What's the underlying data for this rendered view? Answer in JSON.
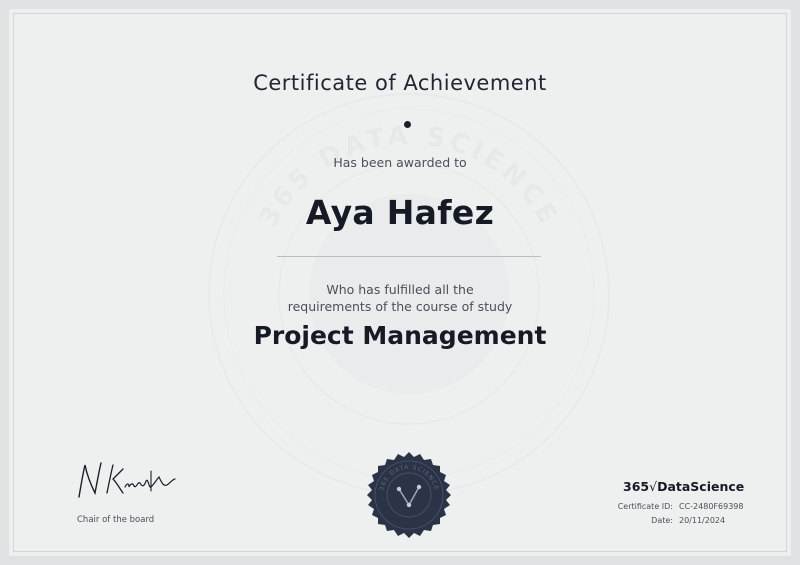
{
  "certificate": {
    "title": "Certificate of Achievement",
    "awarded_text": "Has been awarded to",
    "recipient_name": "Aya Hafez",
    "fulfilled_line1": "Who has fulfilled all the",
    "fulfilled_line2": "requirements of the course of study",
    "course_name": "Project Management"
  },
  "watermark": {
    "text": "365 DATA SCIENCE"
  },
  "signature": {
    "text": "N Krastev",
    "label": "Chair of the board"
  },
  "brand": {
    "number": "365",
    "check": "√",
    "name": "DataScience"
  },
  "meta": {
    "certificate_id_label": "Certificate ID:",
    "certificate_id_value": "CC-2480F69398",
    "date_label": "Date:",
    "date_value": "20/11/2024"
  },
  "colors": {
    "background": "#eef0f0",
    "text": "#1b1f2a",
    "seal": "#2a3446"
  }
}
